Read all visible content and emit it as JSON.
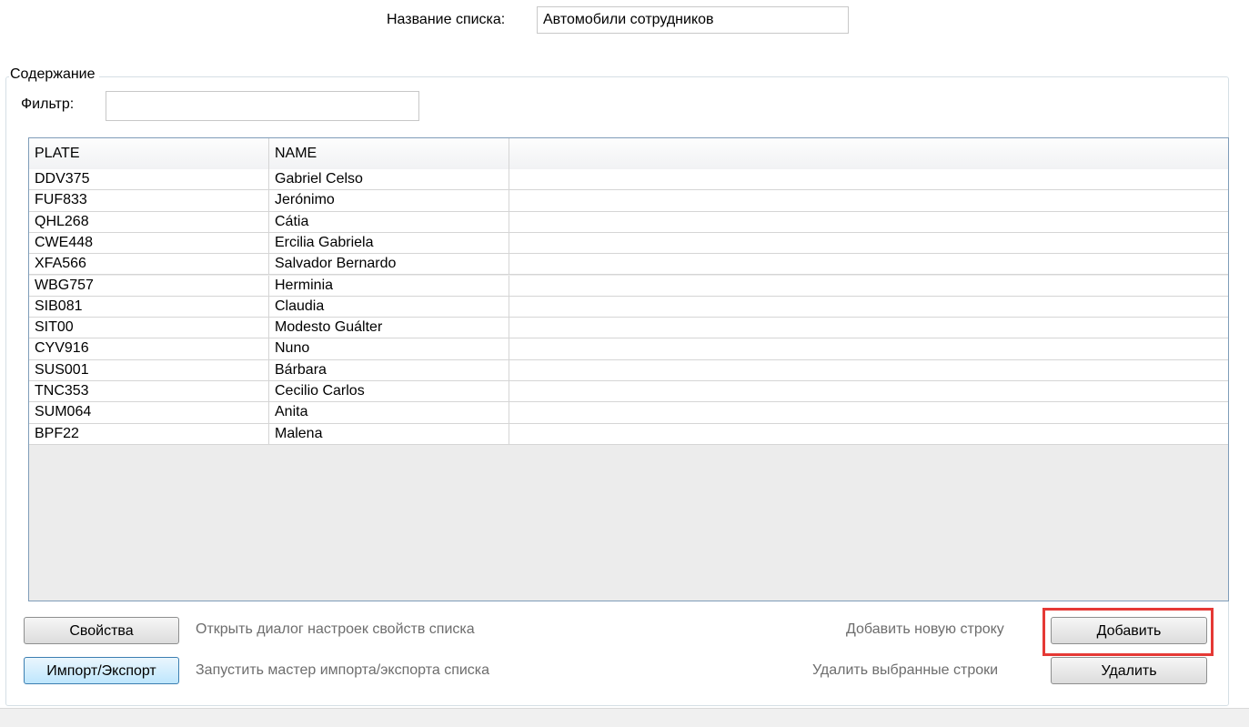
{
  "list_name": {
    "label": "Название списка:",
    "value": "Автомобили сотрудников"
  },
  "group": {
    "title": "Содержание"
  },
  "filter": {
    "label": "Фильтр:",
    "value": ""
  },
  "grid": {
    "columns": [
      "PLATE",
      "NAME",
      ""
    ],
    "rows": [
      [
        "DDV375",
        "Gabriel Celso"
      ],
      [
        "FUF833",
        "Jerónimo"
      ],
      [
        "QHL268",
        "Cátia"
      ],
      [
        "CWE448",
        "Ercilia Gabriela"
      ],
      [
        "XFA566",
        "Salvador Bernardo"
      ],
      [
        "WBG757",
        "Herminia"
      ],
      [
        "SIB081",
        "Claudia"
      ],
      [
        "SIT00",
        "Modesto Guálter"
      ],
      [
        "CYV916",
        "Nuno"
      ],
      [
        "SUS001",
        "Bárbara"
      ],
      [
        "TNC353",
        "Cecilio Carlos"
      ],
      [
        "SUM064",
        "Anita"
      ],
      [
        "BPF22",
        "Malena"
      ]
    ]
  },
  "actions": {
    "properties": {
      "label": "Свойства",
      "description": "Открыть диалог настроек свойств списка"
    },
    "import_export": {
      "label": "Импорт/Экспорт",
      "description": "Запустить мастер импорта/экспорта списка"
    },
    "add": {
      "label": "Добавить",
      "description": "Добавить новую строку"
    },
    "delete": {
      "label": "Удалить",
      "description": "Удалить выбранные строки"
    }
  },
  "colors": {
    "highlight": "#e53935",
    "grid_border": "#7f9db9",
    "empty_area": "#ececec"
  }
}
